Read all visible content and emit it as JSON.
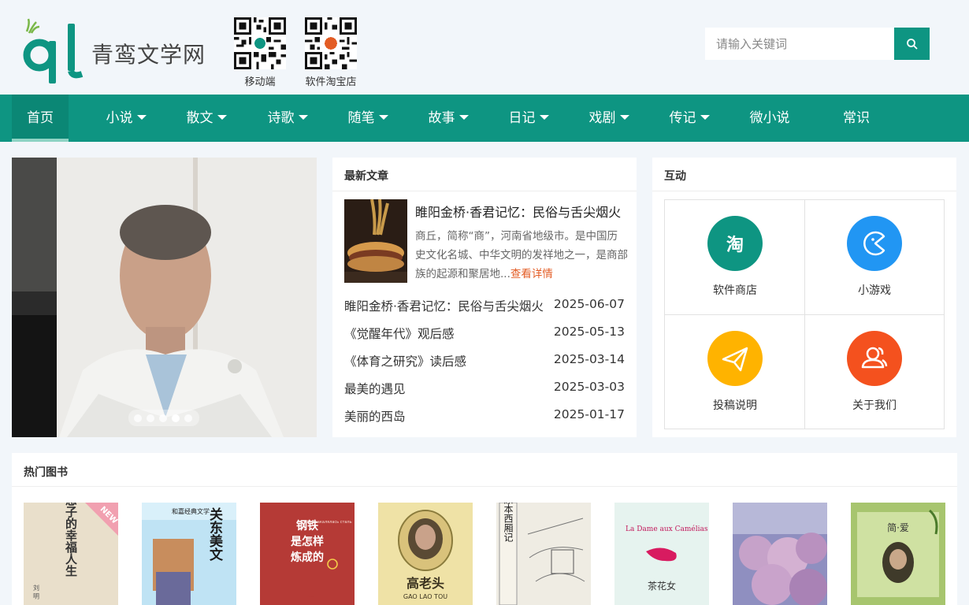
{
  "header": {
    "site_name": "青鸾文学网",
    "qr_mobile_label": "移动端",
    "qr_shop_label": "软件淘宝店",
    "search_placeholder": "请输入关键词"
  },
  "nav": {
    "items": [
      {
        "label": "首页",
        "active": true,
        "dropdown": false
      },
      {
        "label": "小说",
        "dropdown": true
      },
      {
        "label": "散文",
        "dropdown": true
      },
      {
        "label": "诗歌",
        "dropdown": true
      },
      {
        "label": "随笔",
        "dropdown": true
      },
      {
        "label": "故事",
        "dropdown": true
      },
      {
        "label": "日记",
        "dropdown": true
      },
      {
        "label": "戏剧",
        "dropdown": true
      },
      {
        "label": "传记",
        "dropdown": true
      },
      {
        "label": "微小说",
        "dropdown": false
      },
      {
        "label": "常识",
        "dropdown": false
      }
    ]
  },
  "slider": {
    "total_dots": 5,
    "active_dot": 4
  },
  "latest": {
    "title": "最新文章",
    "featured": {
      "title": "睢阳金桥·香君记忆：民俗与舌尖烟火",
      "desc": "商丘，简称“商”，河南省地级市。是中国历史文化名城、中华文明的发祥地之一，是商部族的起源和聚居地...",
      "more": "查看详情"
    },
    "articles": [
      {
        "title": "睢阳金桥·香君记忆：民俗与舌尖烟火",
        "date": "2025-06-07"
      },
      {
        "title": "《觉醒年代》观后感",
        "date": "2025-05-13"
      },
      {
        "title": "《体育之研究》读后感",
        "date": "2025-03-14"
      },
      {
        "title": "最美的遇见",
        "date": "2025-03-03"
      },
      {
        "title": "美丽的西岛",
        "date": "2025-01-17"
      }
    ]
  },
  "interact": {
    "title": "互动",
    "items": [
      {
        "label": "软件商店",
        "icon": "taobao-icon",
        "color": "#0e9582"
      },
      {
        "label": "小游戏",
        "icon": "game-icon",
        "color": "#2196f3"
      },
      {
        "label": "投稿说明",
        "icon": "paper-plane-icon",
        "color": "#ffb300"
      },
      {
        "label": "关于我们",
        "icon": "users-icon",
        "color": "#f4511e"
      }
    ]
  },
  "books": {
    "title": "热门图书",
    "items": [
      {
        "title": "老憨子的幸福人生",
        "author": "刘 明",
        "badge": "NEW"
      },
      {
        "title": "关东美文",
        "publisher": "和嘉经典文学"
      },
      {
        "title": "钢铁是怎样炼成的",
        "subtitle": "Kak закалялась сталь"
      },
      {
        "title": "高老头",
        "subtitle": "GAO LAO TOU"
      },
      {
        "title": "原本西厢记"
      },
      {
        "title": "茶花女",
        "subtitle": "La Dame aux Camélias"
      },
      {
        "title": ""
      },
      {
        "title": "简·爱"
      }
    ]
  },
  "colors": {
    "primary": "#0e9582",
    "accent": "#e35c24"
  }
}
